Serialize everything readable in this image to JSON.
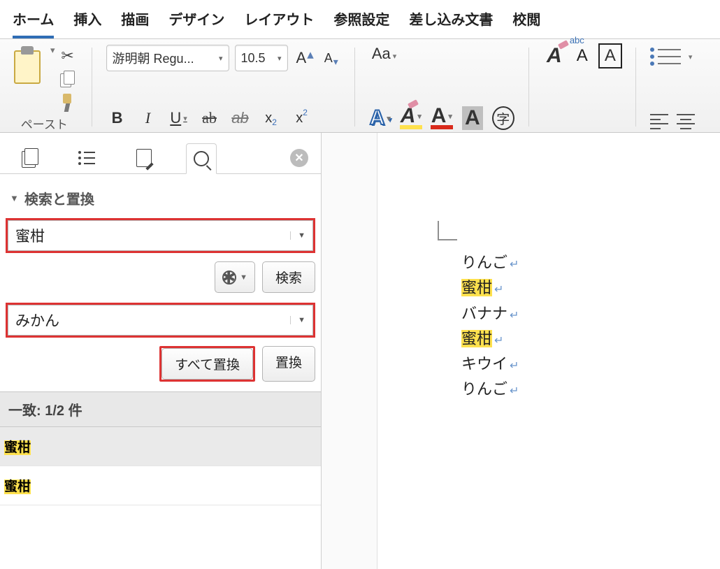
{
  "tabs": [
    "ホーム",
    "挿入",
    "描画",
    "デザイン",
    "レイアウト",
    "参照設定",
    "差し込み文書",
    "校閲"
  ],
  "activeTab": 0,
  "toolbar": {
    "paste_label": "ペースト",
    "font_name": "游明朝 Regu...",
    "font_size": "10.5",
    "case_label": "Aa",
    "circle_label": "字"
  },
  "sidebar": {
    "panel_title": "検索と置換",
    "search_value": "蜜柑",
    "replace_value": "みかん",
    "search_btn": "検索",
    "replace_all_btn": "すべて置換",
    "replace_btn": "置換",
    "matches_header": "一致: 1/2 件",
    "matches": [
      "蜜柑",
      "蜜柑"
    ],
    "selected_match": 0
  },
  "document": {
    "lines": [
      {
        "text": "りんご",
        "highlight": false
      },
      {
        "text": "蜜柑",
        "highlight": true
      },
      {
        "text": "バナナ",
        "highlight": false
      },
      {
        "text": "蜜柑",
        "highlight": true
      },
      {
        "text": "キウイ",
        "highlight": false
      },
      {
        "text": "りんご",
        "highlight": false
      }
    ]
  }
}
